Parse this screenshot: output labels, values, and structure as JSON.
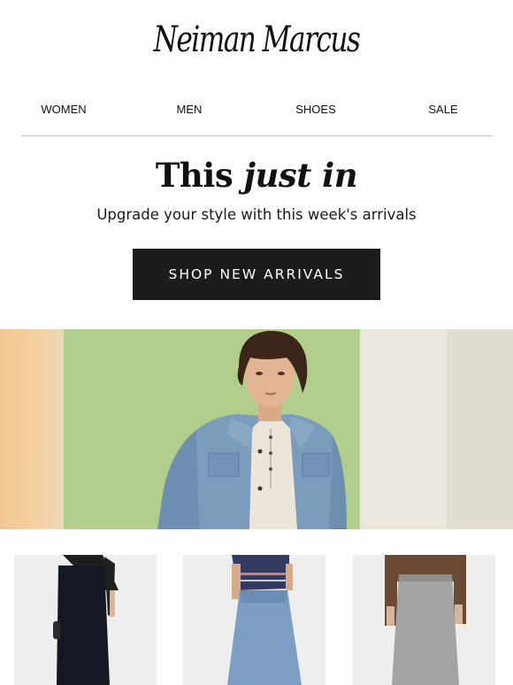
{
  "brand": {
    "name": "Neiman Marcus"
  },
  "nav": {
    "items": [
      "WOMEN",
      "MEN",
      "SHOES",
      "SALE"
    ]
  },
  "headline": {
    "part1": "This",
    "part2": "just in"
  },
  "subhead": "Upgrade your style with this week's arrivals",
  "cta": {
    "label": "SHOP NEW ARRIVALS"
  },
  "hero": {
    "alt": "Model in a suede denim-style jacket over a henley in front of a green backdrop"
  },
  "products": [
    {
      "alt": "Black knit midi skirt"
    },
    {
      "alt": "Light wash denim maxi skirt"
    },
    {
      "alt": "Gray knit maxi skirt"
    }
  ],
  "colors": {
    "text": "#111111",
    "cta_bg": "#1c1c1c",
    "cta_text": "#ffffff",
    "divider": "#bdbdbd"
  }
}
